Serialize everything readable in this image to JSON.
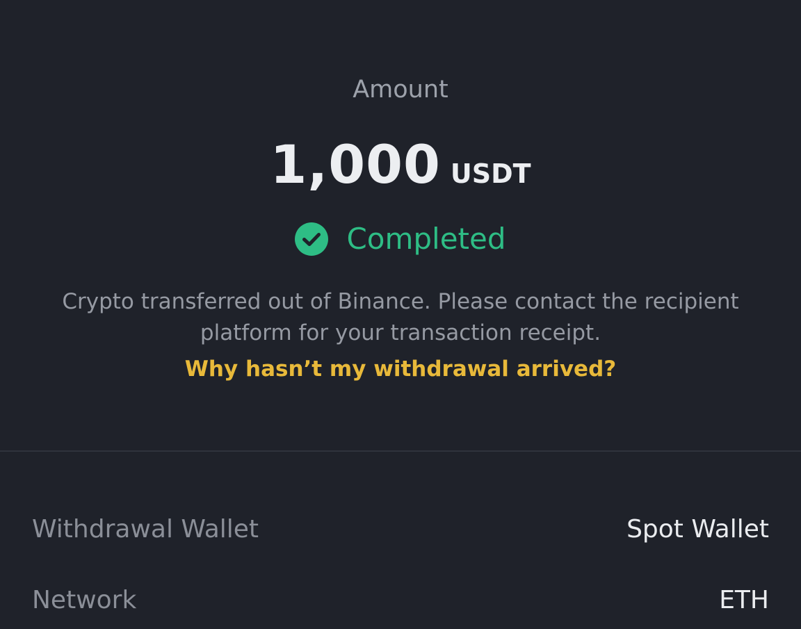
{
  "summary": {
    "amount_label": "Amount",
    "amount_value": "1,000",
    "amount_unit": "USDT",
    "status": "Completed",
    "status_icon": "check-circle-icon",
    "status_color": "#2ebd85",
    "description": "Crypto transferred out of Binance. Please contact the recipient platform for your transaction receipt.",
    "help_link": "Why hasn’t my withdrawal arrived?",
    "link_color": "#e8b93a"
  },
  "details": [
    {
      "label": "Withdrawal Wallet",
      "value": "Spot Wallet"
    },
    {
      "label": "Network",
      "value": "ETH"
    }
  ],
  "theme": {
    "background": "#1f222a"
  }
}
